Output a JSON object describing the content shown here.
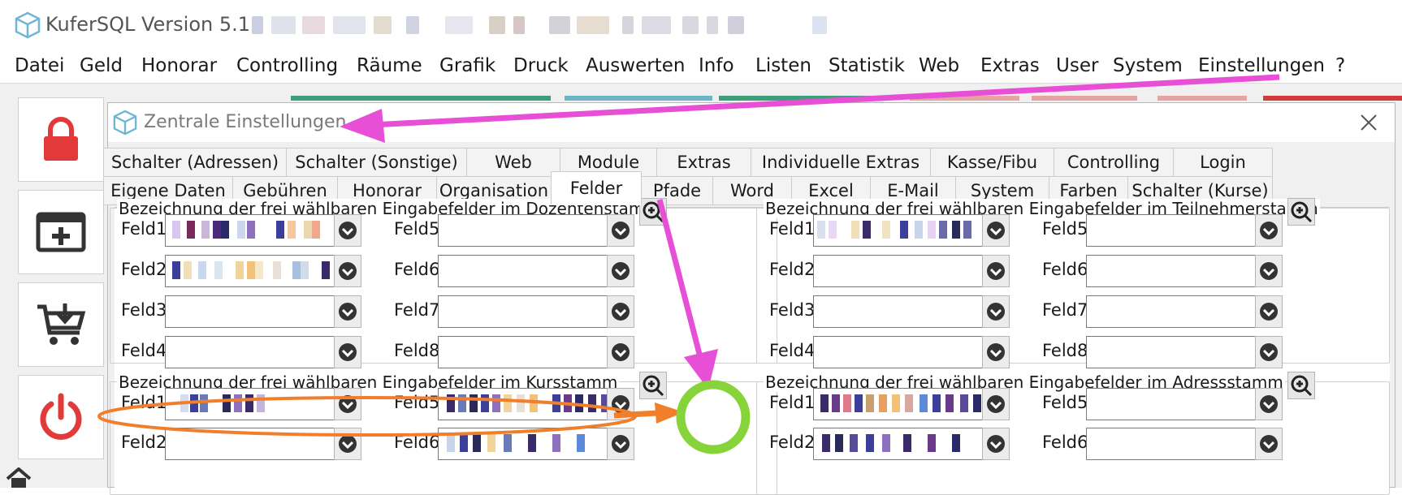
{
  "app": {
    "title": "KuferSQL Version 5.11"
  },
  "menu": [
    "Datei",
    "Geld",
    "Honorar",
    "Controlling",
    "Räume",
    "Grafik",
    "Druck",
    "Auswerten",
    "Info",
    "Listen",
    "Statistik",
    "Web",
    "Extras",
    "User",
    "System",
    "Einstellungen",
    "?"
  ],
  "toolbar": {
    "buttons": [
      "lock-icon",
      "add-window-icon",
      "cart-download-icon",
      "power-icon"
    ],
    "home": "home-icon"
  },
  "dialog": {
    "title": "Zentrale Einstellungen",
    "tabs_row1": [
      "Schalter (Adressen)",
      "Schalter (Sonstige)",
      "Web",
      "Module",
      "Extras",
      "Individuelle Extras",
      "Kasse/Fibu",
      "Controlling",
      "Login"
    ],
    "tabs_row2": [
      "Eigene Daten",
      "Gebühren",
      "Honorar",
      "Organisation",
      "Felder",
      "Pfade",
      "Word",
      "Excel",
      "E-Mail",
      "System",
      "Farben",
      "Schalter (Kurse)"
    ],
    "active_tab": "Felder",
    "groups": [
      {
        "title": "Bezeichnung der frei wählbaren Eingabefelder im Dozentenstamm",
        "labels": [
          "Feld1:",
          "Feld2:",
          "Feld3:",
          "Feld4:",
          "Feld5:",
          "Feld6:",
          "Feld7:",
          "Feld8:"
        ]
      },
      {
        "title": "Bezeichnung der frei wählbaren Eingabefelder im Teilnehmerstamm",
        "labels": [
          "Feld1:",
          "Feld2:",
          "Feld3:",
          "Feld4:",
          "Feld5:",
          "Feld6:",
          "Feld7:",
          "Feld8:"
        ]
      },
      {
        "title": "Bezeichnung der frei wählbaren Eingabefelder im Kursstamm",
        "labels": [
          "Feld1:",
          "Feld2:",
          "Feld5:",
          "Feld6:"
        ]
      },
      {
        "title": "Bezeichnung der frei wählbaren Eingabefelder im Adressstamm",
        "labels": [
          "Feld1:",
          "Feld2:",
          "Feld5:",
          "Feld6:"
        ]
      }
    ]
  },
  "annotation_colors": {
    "magenta_arrow": "#e64fd6",
    "orange_highlight": "#f07f2c",
    "green_circle": "#86d33a"
  }
}
